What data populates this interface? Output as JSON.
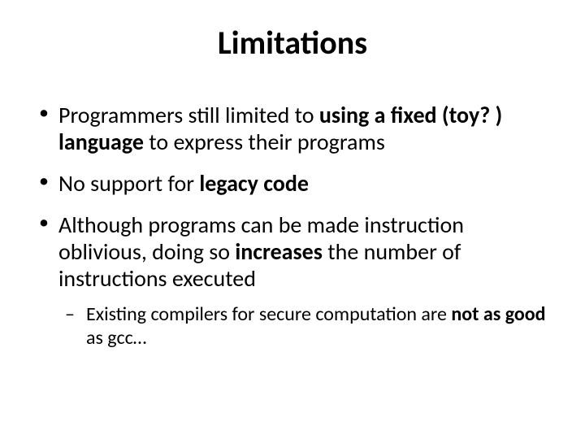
{
  "title": "Limitations",
  "bullets": {
    "b1": {
      "t1": "Programmers still limited to ",
      "t2": "using a fixed (toy? ) language",
      "t3": " to express their programs"
    },
    "b2": {
      "t1": "No support for ",
      "t2": "legacy code"
    },
    "b3": {
      "t1": "Although programs can be made instruction oblivious, doing so ",
      "t2": "increases",
      "t3": " the number of instructions executed",
      "sub1": {
        "t1": "Existing compilers for secure computation are ",
        "t2": "not as good",
        "t3": " as gcc…"
      }
    }
  }
}
